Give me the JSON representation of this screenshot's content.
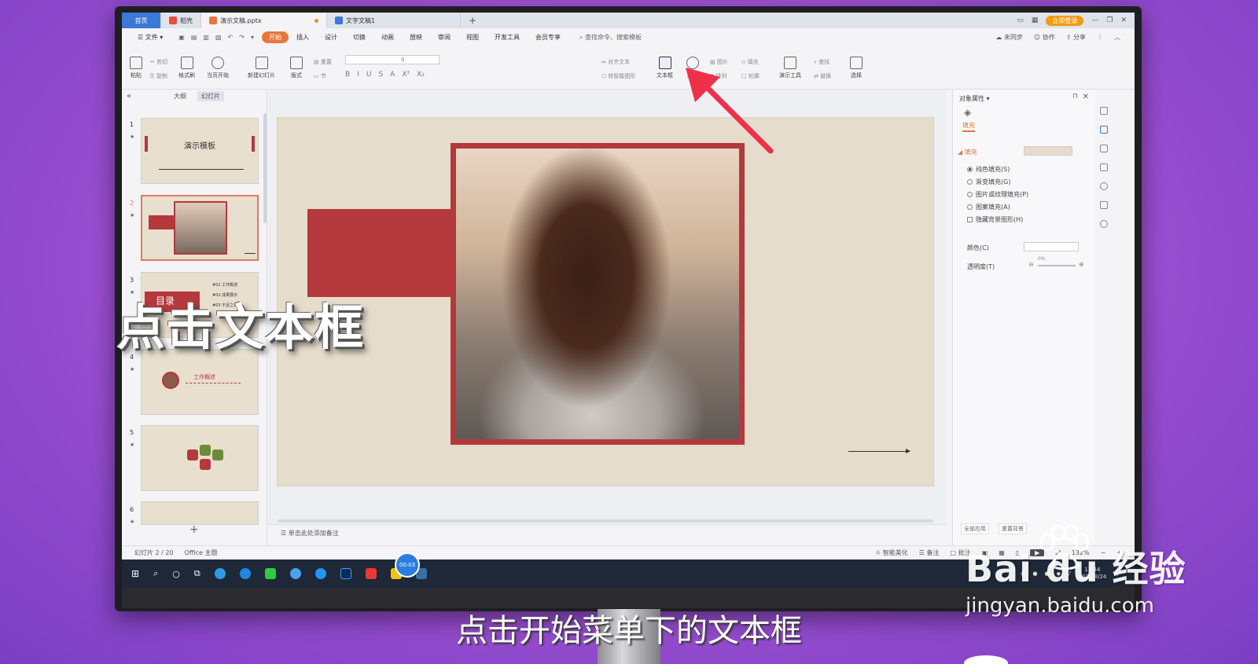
{
  "tabs": {
    "home": "首页",
    "store": "稻壳",
    "document": "演示文稿.pptx",
    "text_doc": "文字文稿1",
    "add": "+"
  },
  "titlebar": {
    "login": "立即登录"
  },
  "menu": {
    "file": "文件",
    "items": [
      "开始",
      "插入",
      "设计",
      "切换",
      "动画",
      "放映",
      "审阅",
      "视图",
      "开发工具",
      "会员专享"
    ],
    "search": "查找命令、搜索模板",
    "unsynced": "未同步",
    "collaborate": "协作",
    "share": "分享"
  },
  "ribbon": {
    "paste": "粘贴",
    "cut": "剪切",
    "copy": "复制",
    "format_painter": "格式刷",
    "from_current": "当页开始",
    "new_slide": "新建幻灯片",
    "layout": "版式",
    "reset": "重置",
    "section": "节",
    "font_size": "0",
    "align_text": "对齐文本",
    "smart_graphic": "转智能图形",
    "textbox": "文本框",
    "shape": "形状",
    "picture": "图片",
    "fill": "填充",
    "arrange": "排列",
    "outline": "轮廓",
    "presenter_tools": "演示工具",
    "find": "查找",
    "replace": "替换",
    "select": "选择"
  },
  "left_panel": {
    "outline_tab": "大纲",
    "slides_tab": "幻灯片",
    "slide1_title": "演示模板",
    "slide3_title": "目录",
    "slide3_items": [
      "#01 工作概述",
      "#02 成果展示",
      "#03 不足之处"
    ],
    "slide4_title": "工作概述",
    "slide_numbers": [
      "1",
      "2",
      "3",
      "4",
      "5",
      "6"
    ]
  },
  "notes": {
    "placeholder": "单击此处添加备注"
  },
  "properties": {
    "title": "对象属性",
    "fill_tab": "填充",
    "fill_section": "填充",
    "options": [
      "纯色填充(S)",
      "渐变填充(G)",
      "图片或纹理填充(P)",
      "图案填充(A)"
    ],
    "hide_bg": "隐藏背景图形(H)",
    "color_label": "颜色(C)",
    "transparency_label": "透明度(T)",
    "transparency_value": "0%",
    "apply_all": "全部应用",
    "reset_bg": "重置背景"
  },
  "status": {
    "slide_info": "幻灯片 2 / 20",
    "theme": "Office 主题",
    "smart_beautify": "智能美化",
    "notes": "备注",
    "comments": "批注",
    "zoom": "132%"
  },
  "taskbar": {
    "timer": "00:03",
    "time": "13:44",
    "date": "2022/8/24"
  },
  "overlay": {
    "caption": "点击文本框",
    "subtitle": "点击开始菜单下的文本框"
  },
  "watermark": {
    "brand": "Bai du 经验",
    "url": "jingyan.baidu.com"
  },
  "colors": {
    "accent_orange": "#e8763a",
    "slide_red": "#b5383c",
    "slide_bg": "#e5dccc",
    "arrow_red": "#f0304a"
  }
}
